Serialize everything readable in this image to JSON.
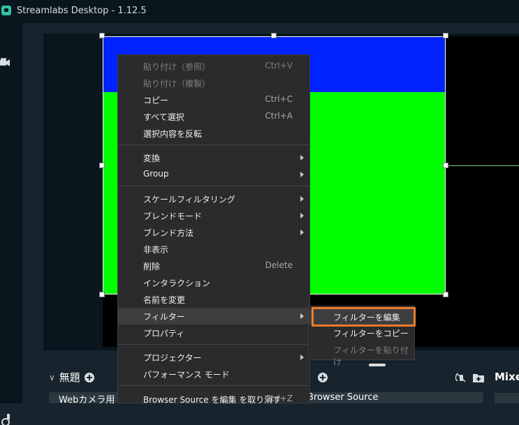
{
  "window": {
    "title": "Streamlabs Desktop - 1.12.5"
  },
  "colors": {
    "accent": "#31c3a2",
    "highlight": "#ee7b2a",
    "blue_source": "#0022ff",
    "green_source": "#00ff00"
  },
  "context_menu": {
    "items": [
      {
        "label": "貼り付け（参照）",
        "shortcut": "Ctrl+V",
        "disabled": true
      },
      {
        "label": "貼り付け（複製）",
        "shortcut": "",
        "disabled": true
      },
      {
        "label": "コピー",
        "shortcut": "Ctrl+C"
      },
      {
        "label": "すべて選択",
        "shortcut": "Ctrl+A"
      },
      {
        "label": "選択内容を反転",
        "shortcut": ""
      },
      {
        "label": "変換",
        "submenu": true
      },
      {
        "label": "Group",
        "submenu": true
      },
      {
        "label": "スケールフィルタリング",
        "submenu": true
      },
      {
        "label": "ブレンドモード",
        "submenu": true
      },
      {
        "label": "ブレンド方法",
        "submenu": true
      },
      {
        "label": "非表示"
      },
      {
        "label": "削除",
        "shortcut": "Delete"
      },
      {
        "label": "インタラクション"
      },
      {
        "label": "名前を変更"
      },
      {
        "label": "フィルター",
        "submenu": true,
        "active": true
      },
      {
        "label": "プロパティ"
      },
      {
        "label": "プロジェクター",
        "submenu": true
      },
      {
        "label": "パフォーマンス モード"
      },
      {
        "label": "Browser Source を編集 を取り消す",
        "shortcut": "Ctrl+Z"
      }
    ]
  },
  "filter_submenu": {
    "items": [
      {
        "label": "フィルターを編集"
      },
      {
        "label": "フィルターをコピー"
      },
      {
        "label": "フィルターを貼り付け",
        "disabled": true
      }
    ]
  },
  "scenes": {
    "title": "無題",
    "current_scene": "Webカメラ用"
  },
  "sources": {
    "current_source": "Browser Source"
  },
  "mixer": {
    "title": "Mixe"
  }
}
